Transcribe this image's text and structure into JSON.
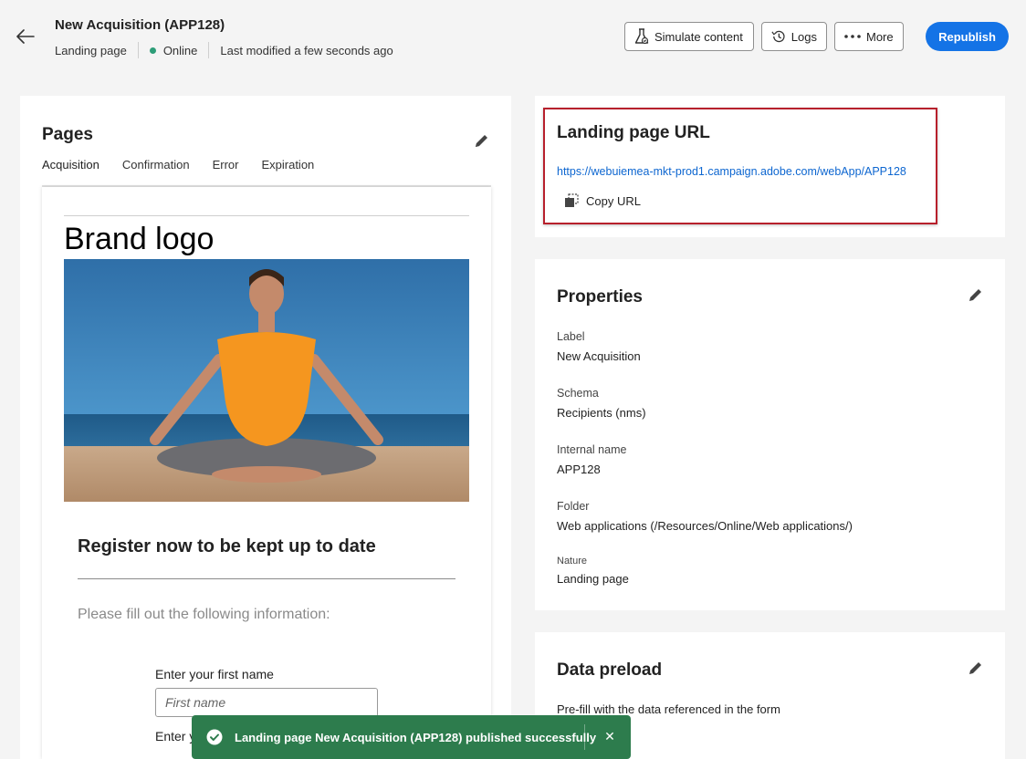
{
  "header": {
    "title": "New Acquisition (APP128)",
    "type": "Landing page",
    "status": "Online",
    "modified": "Last modified a few seconds ago",
    "simulate_label": "Simulate content",
    "logs_label": "Logs",
    "more_label": "More",
    "republish_label": "Republish"
  },
  "pages": {
    "title": "Pages",
    "tabs": [
      "Acquisition",
      "Confirmation",
      "Error",
      "Expiration"
    ],
    "active_tab": "Acquisition",
    "preview": {
      "brand_logo": "Brand logo",
      "register_title": "Register now to be kept up to date",
      "fill_text": "Please fill out the following information:",
      "first_name_label": "Enter your first name",
      "first_name_placeholder": "First name",
      "last_name_label_partial": "Enter y"
    }
  },
  "url_panel": {
    "title": "Landing page URL",
    "url": "https://webuiemea-mkt-prod1.campaign.adobe.com/webApp/APP128",
    "copy_label": "Copy URL"
  },
  "properties": {
    "title": "Properties",
    "label_label": "Label",
    "label_value": "New Acquisition",
    "schema_label": "Schema",
    "schema_value": "Recipients (nms)",
    "internal_label": "Internal name",
    "internal_value": "APP128",
    "folder_label": "Folder",
    "folder_value": "Web applications (/Resources/Online/Web applications/)",
    "nature_label": "Nature",
    "nature_value": "Landing page"
  },
  "preload": {
    "title": "Data preload",
    "text": "Pre-fill with the data referenced in the form"
  },
  "toast": {
    "message": "Landing page New Acquisition (APP128) published successfully",
    "close": "✕"
  },
  "colors": {
    "accent": "#1473e6",
    "online": "#2d9d78",
    "toast": "#2d7c4d",
    "highlight": "#b7202c",
    "link": "#0d66d0"
  }
}
